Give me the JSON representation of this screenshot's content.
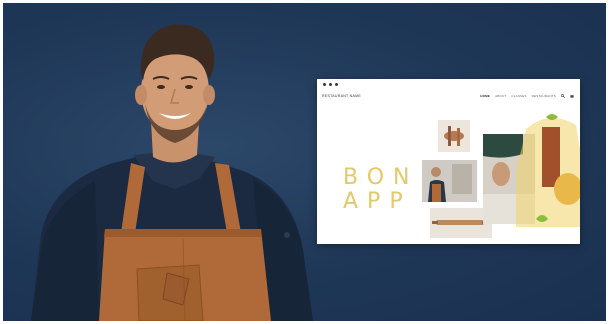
{
  "browser": {
    "site_logo": "RESTAURANT NAME",
    "nav": {
      "items": [
        "HOME",
        "ABOUT",
        "CLASSES",
        "RESTAURANTS"
      ],
      "active": "HOME"
    },
    "icons": [
      "window-dots-icon",
      "search-icon",
      "cart-icon"
    ],
    "hero": {
      "line1": "BON",
      "line2": "APP"
    }
  },
  "colors": {
    "background": "#1f3757",
    "accent_yellow": "#e4c96a",
    "apron_brown": "#b06a3a",
    "chef_jacket": "#1c2a40"
  }
}
